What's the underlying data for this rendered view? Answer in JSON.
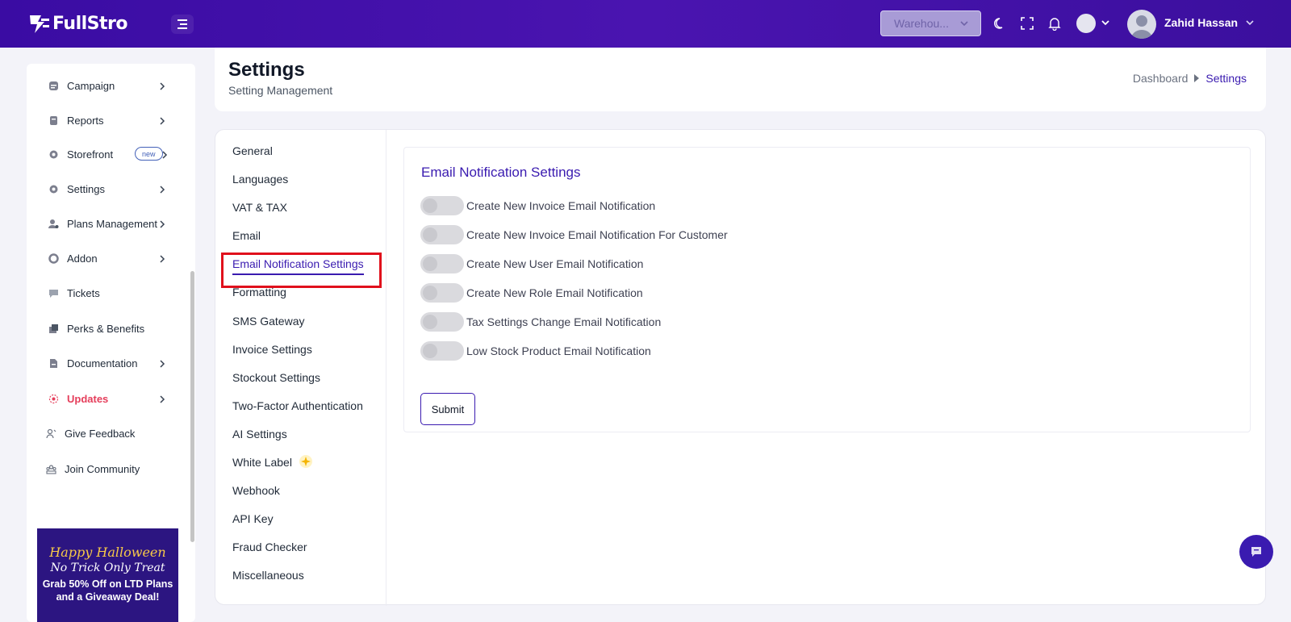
{
  "app": {
    "logo_text": "FullStro"
  },
  "topbar": {
    "warehouse_label": "Warehou...",
    "user_name": "Zahid Hassan"
  },
  "sidebar": {
    "items": [
      {
        "label": "Campaign",
        "icon": "campaign-icon"
      },
      {
        "label": "Reports",
        "icon": "reports-icon"
      },
      {
        "label": "Storefront",
        "icon": "storefront-icon",
        "badge": "new"
      },
      {
        "label": "Settings",
        "icon": "settings-icon"
      },
      {
        "label": "Plans Management",
        "icon": "plans-icon"
      },
      {
        "label": "Addon",
        "icon": "addon-icon"
      },
      {
        "label": "Tickets",
        "icon": "tickets-icon"
      },
      {
        "label": "Perks & Benefits",
        "icon": "perks-icon"
      },
      {
        "label": "Documentation",
        "icon": "documentation-icon"
      },
      {
        "label": "Updates",
        "icon": "updates-icon"
      },
      {
        "label": "Give Feedback",
        "icon": "feedback-icon"
      },
      {
        "label": "Join Community",
        "icon": "community-icon"
      }
    ],
    "promo": {
      "line1": "Happy Halloween",
      "line2": "No Trick Only Treat",
      "line3": "Grab 50% Off on LTD Plans",
      "line4": "and a Giveaway Deal!"
    }
  },
  "header": {
    "title": "Settings",
    "subtitle": "Setting Management",
    "breadcrumb": [
      "Dashboard",
      "Settings"
    ]
  },
  "settings_menu": [
    "General",
    "Languages",
    "VAT & TAX",
    "Email",
    "Email Notification Settings",
    "Formatting",
    "SMS Gateway",
    "Invoice Settings",
    "Stockout Settings",
    "Two-Factor Authentication",
    "AI Settings",
    "White Label",
    "Webhook",
    "API Key",
    "Fraud Checker",
    "Miscellaneous"
  ],
  "panel": {
    "title": "Email Notification Settings",
    "toggles": [
      "Create New Invoice Email Notification",
      "Create New Invoice Email Notification For Customer",
      "Create New User Email Notification",
      "Create New Role Email Notification",
      "Tax Settings Change Email Notification",
      "Low Stock Product Email Notification"
    ],
    "submit_label": "Submit"
  },
  "colors": {
    "topbar": "#3a0ca3",
    "accent": "#3a1bb0",
    "highlight_box": "#e0101c",
    "updates_red": "#e53e5b"
  }
}
